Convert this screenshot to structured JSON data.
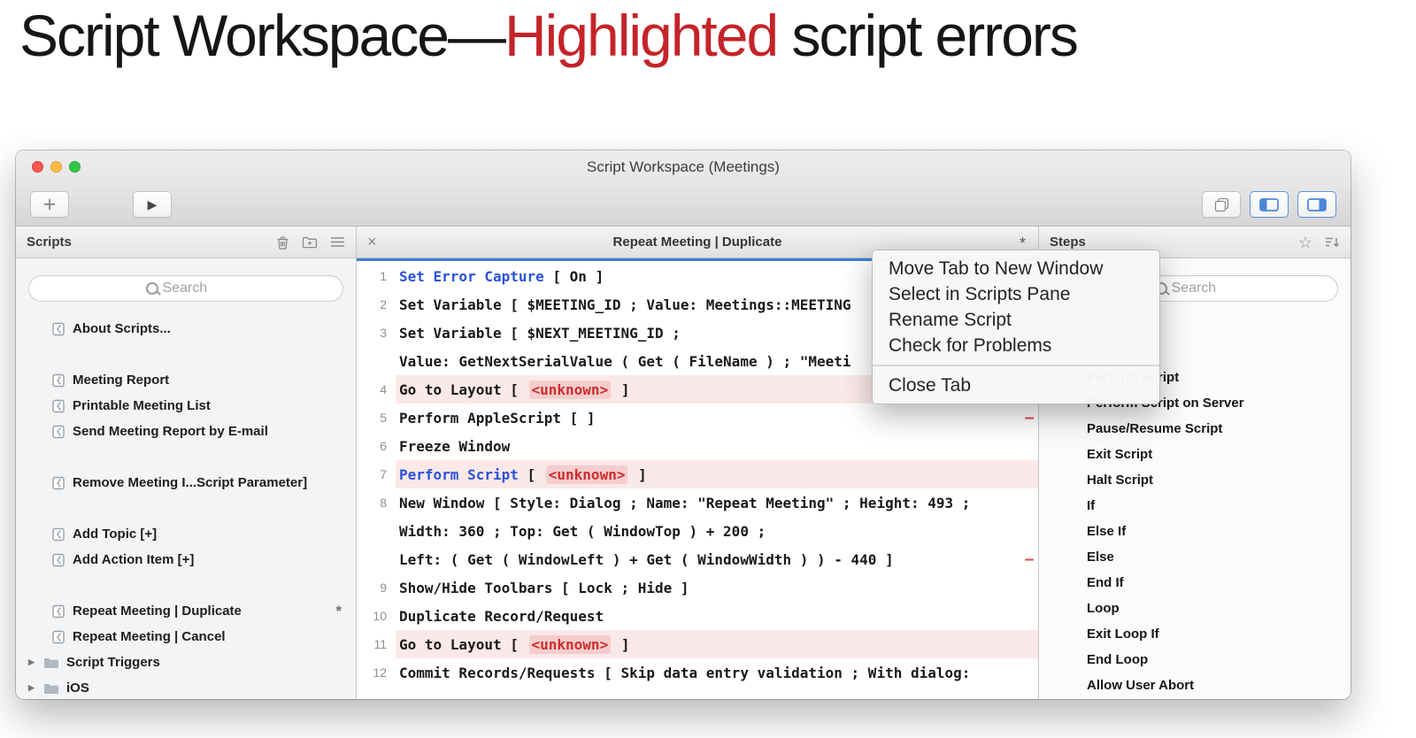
{
  "page_title": {
    "prefix": "Script Workspace",
    "dash": "—",
    "highlight": "Highlighted",
    "suffix": " script errors"
  },
  "icons": {
    "plus": "+",
    "play": "▶",
    "close": "×",
    "star": "☆",
    "disclosure": "▶",
    "search": "magnifier",
    "error_marker_color": "#e04343",
    "accent_blue": "#3f7ed8",
    "error_red": "#ce2c2c",
    "highlight_pink": "#fbe8e8"
  },
  "window": {
    "title": "Script Workspace (Meetings)",
    "scripts_panel": {
      "title": "Scripts",
      "search_placeholder": "Search",
      "items": [
        {
          "type": "script",
          "name": "About Scripts..."
        },
        {
          "type": "spacer"
        },
        {
          "type": "script",
          "name": "Meeting Report"
        },
        {
          "type": "script",
          "name": "Printable Meeting List"
        },
        {
          "type": "script",
          "name": "Send Meeting Report by E-mail"
        },
        {
          "type": "spacer"
        },
        {
          "type": "script",
          "name": "Remove Meeting I...Script Parameter]"
        },
        {
          "type": "spacer"
        },
        {
          "type": "script",
          "name": "Add Topic [+]"
        },
        {
          "type": "script",
          "name": "Add Action Item [+]"
        },
        {
          "type": "spacer"
        },
        {
          "type": "script",
          "name": "Repeat Meeting | Duplicate",
          "marker": "*"
        },
        {
          "type": "script",
          "name": "Repeat Meeting | Cancel"
        },
        {
          "type": "folder",
          "name": "Script Triggers"
        },
        {
          "type": "folder",
          "name": "iOS"
        }
      ]
    },
    "editor": {
      "tab_title": "Repeat Meeting | Duplicate",
      "dirty_marker": "*",
      "error_dash": "—",
      "lines": [
        {
          "num": "1",
          "segments": [
            {
              "text": "Set Error Capture",
              "style": "keyword"
            },
            {
              "text": " [ On ]"
            }
          ]
        },
        {
          "num": "2",
          "segments": [
            {
              "text": "Set Variable [ $MEETING_ID ; Value: Meetings::MEETING"
            }
          ]
        },
        {
          "num": "3",
          "segments": [
            {
              "text": "Set Variable [ $NEXT_MEETING_ID ;"
            }
          ]
        },
        {
          "segments": [
            {
              "text": "Value: GetNextSerialValue ( Get ( FileName ) ; \"Meeti"
            }
          ]
        },
        {
          "num": "4",
          "highlight": true,
          "segments": [
            {
              "text": "Go to Layout [ "
            },
            {
              "text": "<unknown>",
              "style": "error"
            },
            {
              "text": " ]"
            }
          ]
        },
        {
          "num": "5",
          "marker": true,
          "segments": [
            {
              "text": "Perform AppleScript [ ]"
            }
          ]
        },
        {
          "num": "6",
          "segments": [
            {
              "text": "Freeze Window"
            }
          ]
        },
        {
          "num": "7",
          "highlight": true,
          "segments": [
            {
              "text": "Perform Script",
              "style": "keyword"
            },
            {
              "text": " [ "
            },
            {
              "text": "<unknown>",
              "style": "error"
            },
            {
              "text": " ]"
            }
          ]
        },
        {
          "num": "8",
          "segments": [
            {
              "text": "New Window [ Style: Dialog ; Name: \"Repeat Meeting\" ; Height: 493 ;"
            }
          ]
        },
        {
          "segments": [
            {
              "text": "Width: 360 ; Top: Get ( WindowTop ) + 200 ;"
            }
          ]
        },
        {
          "marker": true,
          "segments": [
            {
              "text": "Left: ( Get ( WindowLeft ) + Get ( WindowWidth ) ) - 440 ]"
            }
          ]
        },
        {
          "num": "9",
          "segments": [
            {
              "text": "Show/Hide Toolbars [ Lock ; Hide ]"
            }
          ]
        },
        {
          "num": "10",
          "segments": [
            {
              "text": "Duplicate Record/Request"
            }
          ]
        },
        {
          "num": "11",
          "highlight": true,
          "segments": [
            {
              "text": "Go to Layout [ "
            },
            {
              "text": "<unknown>",
              "style": "error"
            },
            {
              "text": " ]"
            }
          ]
        },
        {
          "num": "12",
          "segments": [
            {
              "text": "Commit Records/Requests [ Skip data entry validation ; With dialog:"
            }
          ]
        }
      ]
    },
    "steps_panel": {
      "title": "Steps",
      "search_placeholder": "Search",
      "items": [
        "Perform Script",
        "Perform Script on Server",
        "Pause/Resume Script",
        "Exit Script",
        "Halt Script",
        "If",
        "Else If",
        "Else",
        "End If",
        "Loop",
        "Exit Loop If",
        "End Loop",
        "Allow User Abort"
      ]
    },
    "context_menu": {
      "groups": [
        {
          "items": [
            "Move Tab to New Window",
            "Select in Scripts Pane",
            "Rename Script",
            "Check for Problems"
          ]
        },
        {
          "items": [
            "Close Tab"
          ]
        }
      ]
    }
  }
}
